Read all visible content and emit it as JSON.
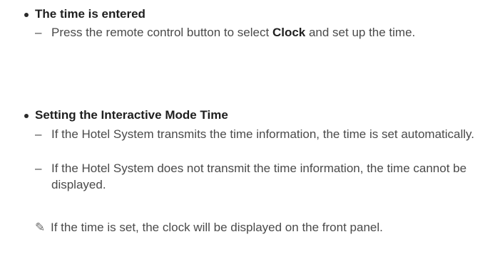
{
  "sections": [
    {
      "heading": "The time is entered",
      "items": [
        {
          "dash": "–",
          "before": "Press the remote control button to select ",
          "bold": "Clock",
          "after": " and set up the time."
        }
      ]
    },
    {
      "heading": "Setting the Interactive Mode Time",
      "items": [
        {
          "dash": "–",
          "text": "If the Hotel System transmits the time information, the time is set automatically."
        },
        {
          "dash": "–",
          "text": "If the Hotel System does not transmit the time information, the time cannot be displayed."
        }
      ]
    }
  ],
  "note": {
    "icon": "pencil-note-icon",
    "glyph": "✎",
    "text": "If the time is set, the clock will be displayed on the front panel."
  }
}
